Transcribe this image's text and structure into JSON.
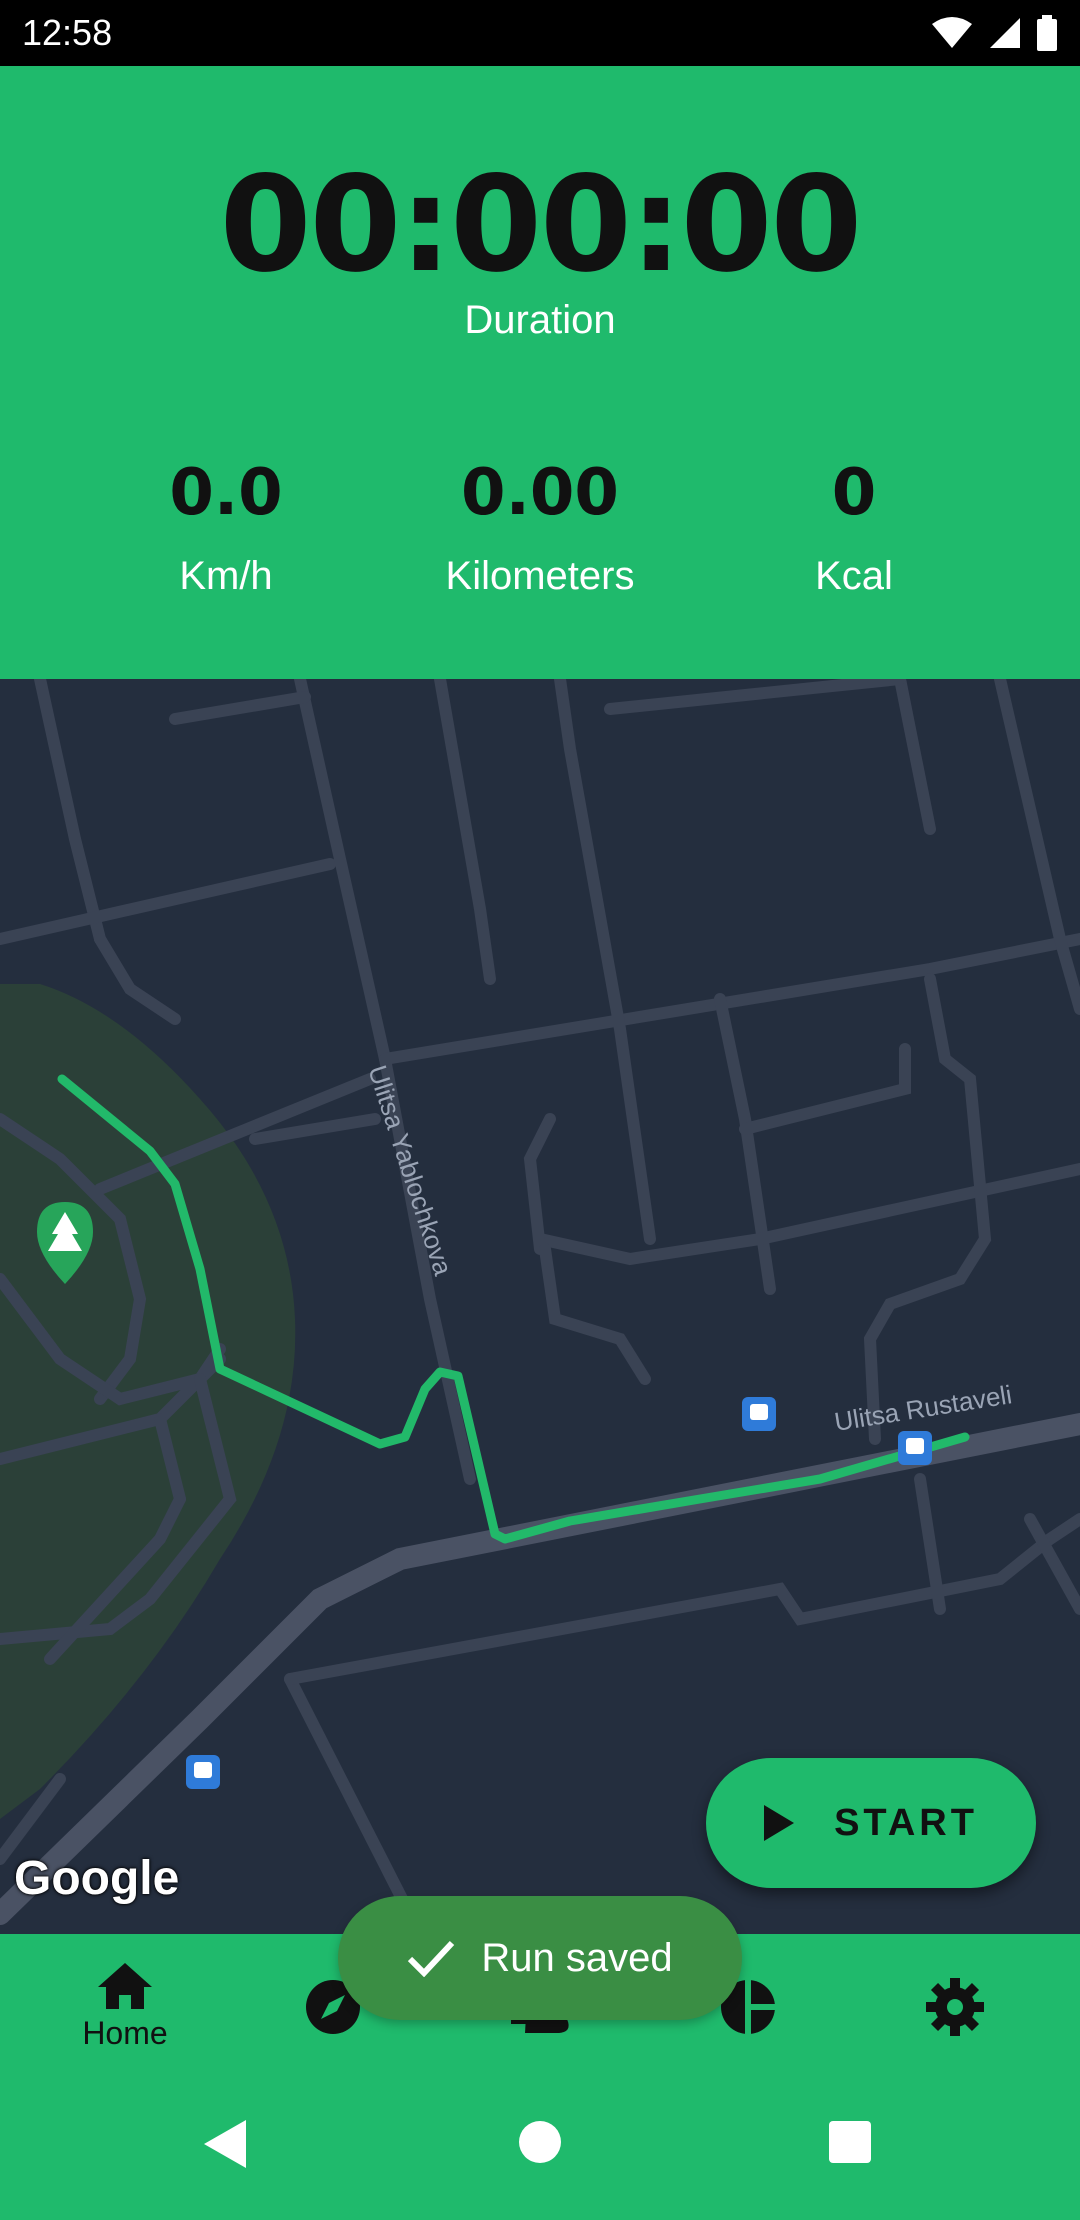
{
  "status_bar": {
    "time": "12:58"
  },
  "timer": {
    "value": "00:00:00",
    "label": "Duration"
  },
  "stats": [
    {
      "value": "0.0",
      "label": "Km/h"
    },
    {
      "value": "0.00",
      "label": "Kilometers"
    },
    {
      "value": "0",
      "label": "Kcal"
    }
  ],
  "map": {
    "street_1": "Ulitsa Yablochkova",
    "street_2": "Ulitsa Rustaveli",
    "logo": "Google",
    "route_color": "#22b96a"
  },
  "start_button": {
    "label": "START",
    "icon": "play-icon"
  },
  "snackbar": {
    "text": "Run saved",
    "icon": "check-icon"
  },
  "bottom_nav": {
    "items": [
      {
        "label": "Home",
        "icon": "home-icon"
      },
      {
        "label": "",
        "icon": "compass-icon"
      },
      {
        "label": "",
        "icon": "run-icon"
      },
      {
        "label": "",
        "icon": "chart-icon"
      },
      {
        "label": "",
        "icon": "settings-icon"
      }
    ]
  },
  "colors": {
    "accent": "#1fba6c",
    "map_bg": "#242e3e",
    "snackbar": "#3a8e44"
  }
}
